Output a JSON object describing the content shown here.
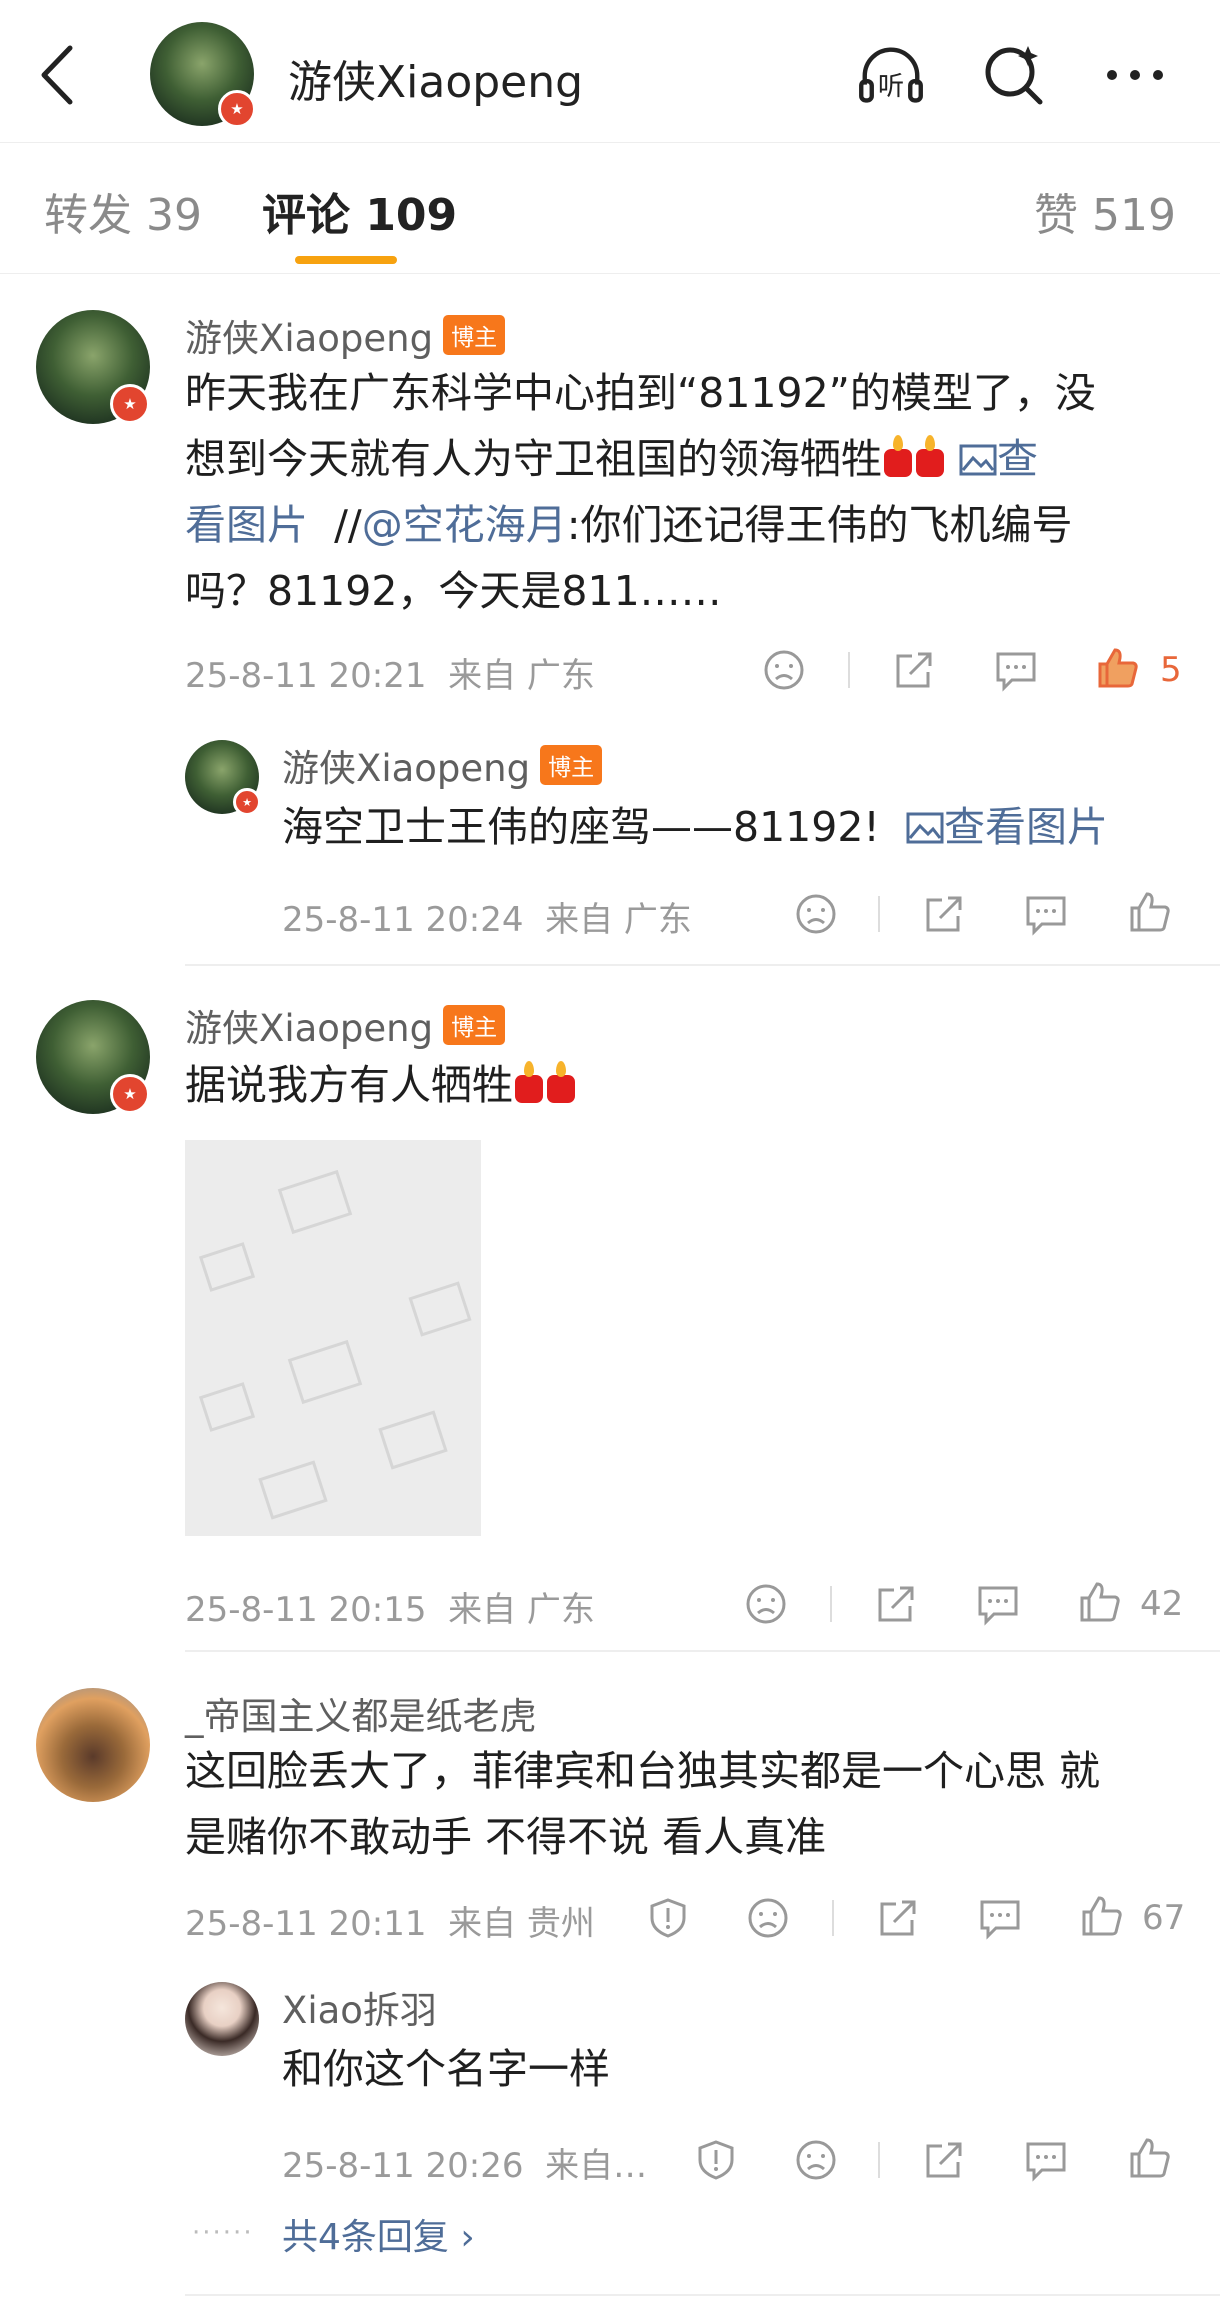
{
  "header": {
    "title": "游侠Xiaopeng",
    "listen_label": "听"
  },
  "tabs": {
    "repost": "转发 39",
    "comments": "评论 109",
    "likes": "赞 519"
  },
  "comments": [
    {
      "user": "游侠Xiaopeng",
      "badge": "博主",
      "text_line1": "昨天我在广东科学中心拍到“81192”的模型了，没",
      "text_line2_a": "想到今天就有人为守卫祖国的领海牺牲",
      "text_line2_b": "查",
      "text_line3_a": "看图片",
      "text_line3_b": "//",
      "text_line3_c": "@空花海月",
      "text_line3_d": ":你们还记得王伟的飞机编号",
      "text_line4": "吗？81192，今天是811……",
      "time": "25-8-11 20:21",
      "from": "来自 广东",
      "likes": "5",
      "reply": {
        "user": "游侠Xiaopeng",
        "badge": "博主",
        "text": "海空卫士王伟的座驾——81192!",
        "link": "查看图片",
        "time": "25-8-11 20:24",
        "from": "来自 广东"
      }
    },
    {
      "user": "游侠Xiaopeng",
      "badge": "博主",
      "text": "据说我方有人牺牲",
      "time": "25-8-11 20:15",
      "from": "来自 广东",
      "likes": "42"
    },
    {
      "user": "_帝国主义都是纸老虎",
      "text_line1": "这回脸丢大了，菲律宾和台独其实都是一个心思 就",
      "text_line2": "是赌你不敢动手 不得不说 看人真准",
      "time": "25-8-11 20:11",
      "from": "来自 贵州",
      "likes": "67",
      "reply": {
        "user": "Xiao拆羽",
        "text": "和你这个名字一样",
        "time": "25-8-11 20:26",
        "from": "来自…"
      },
      "more_replies": "共4条回复 ›"
    }
  ],
  "colors": {
    "accent": "#f7a20f",
    "link": "#4f6d98",
    "host_badge": "#f7771b",
    "like_active": "#e8673a"
  }
}
